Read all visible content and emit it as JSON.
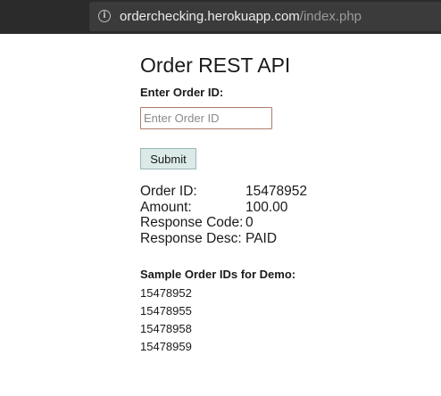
{
  "browser": {
    "url_host": "orderchecking.herokuapp.com",
    "url_path": "/index.php"
  },
  "page": {
    "title": "Order REST API",
    "order_label": "Enter Order ID:",
    "order_input_value": "",
    "order_input_placeholder": "Enter Order ID",
    "submit_label": "Submit"
  },
  "result": [
    {
      "key": "Order ID:",
      "value": "15478952"
    },
    {
      "key": "Amount:",
      "value": "100.00"
    },
    {
      "key": "Response Code:",
      "value": "0"
    },
    {
      "key": "Response Desc:",
      "value": "PAID"
    }
  ],
  "samples": {
    "heading": "Sample Order IDs for Demo:",
    "ids": [
      "15478952",
      "15478955",
      "15478958",
      "15478959"
    ]
  }
}
